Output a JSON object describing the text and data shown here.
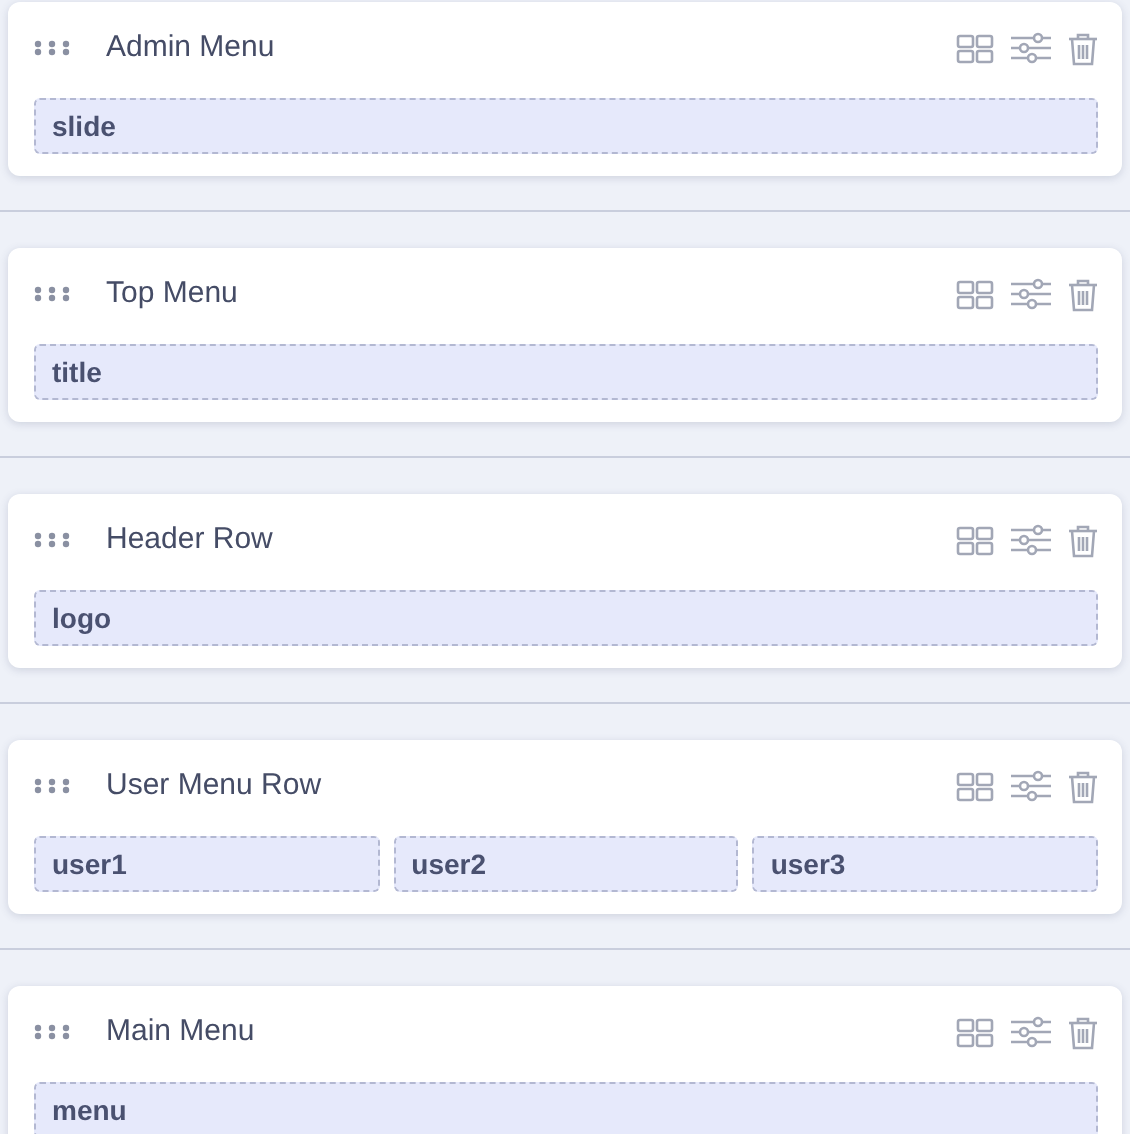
{
  "rows": [
    {
      "title": "Admin Menu",
      "positions": [
        "slide"
      ]
    },
    {
      "title": "Top Menu",
      "positions": [
        "title"
      ]
    },
    {
      "title": "Header Row",
      "positions": [
        "logo"
      ]
    },
    {
      "title": "User Menu Row",
      "positions": [
        "user1",
        "user2",
        "user3"
      ]
    },
    {
      "title": "Main Menu",
      "positions": [
        "menu"
      ]
    }
  ]
}
